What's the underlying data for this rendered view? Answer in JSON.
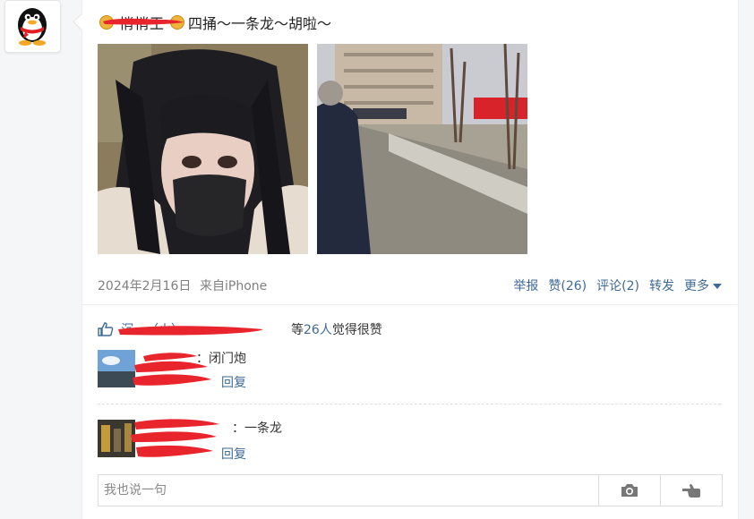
{
  "post": {
    "nickname": "悄悄王",
    "text": "四捅～一条龙～胡啦～"
  },
  "meta": {
    "date": "2024年2月16日",
    "source": "来自iPhone"
  },
  "actions": {
    "report": "举报",
    "like": "赞(26)",
    "comment": "评论(2)",
    "forward": "转发",
    "more": "更多"
  },
  "likes": {
    "names": "沉…（火）",
    "prefix": "等",
    "count": "26人",
    "suffix": "觉得很赞"
  },
  "comments": [
    {
      "author": "",
      "text": "：闭门炮",
      "reply": "回复"
    },
    {
      "author": "",
      "text": "：一条龙",
      "reply": "回复"
    }
  ],
  "input": {
    "placeholder": "我也说一句"
  },
  "icons": [
    "qq-penguin-icon",
    "coin-icon",
    "thumbs-up-icon",
    "camera-icon",
    "gesture-icon",
    "chevron-down-icon"
  ],
  "colors": {
    "link": "#3f6a97",
    "meta": "#808080",
    "redaction": "#e8242c"
  }
}
